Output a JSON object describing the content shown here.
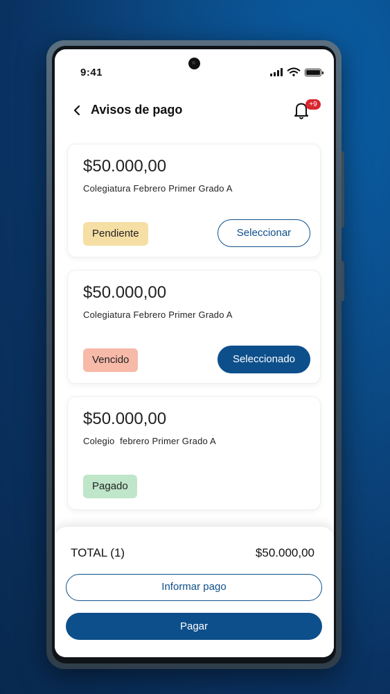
{
  "status_bar": {
    "time": "9:41"
  },
  "header": {
    "title": "Avisos de pago",
    "notification_count": "+9"
  },
  "cards": [
    {
      "amount": "$50.000,00",
      "description": "Colegiatura Febrero Primer Grado A",
      "status": "Pendiente",
      "action": "Seleccionar"
    },
    {
      "amount": "$50.000,00",
      "description": "Colegiatura Febrero Primer Grado A",
      "status": "Vencido",
      "action": "Seleccionado"
    },
    {
      "amount": "$50.000,00",
      "description": "Colegio  febrero Primer Grado A",
      "status": "Pagado"
    }
  ],
  "footer": {
    "total_label": "TOTAL  (1)",
    "total_amount": "$50.000,00",
    "inform_button": "Informar pago",
    "pay_button": "Pagar"
  },
  "colors": {
    "primary": "#0d4f8b",
    "pendiente": "#f6dfa4",
    "vencido": "#f7b9a8",
    "pagado": "#bfe6c9",
    "badge": "#d9262f"
  }
}
